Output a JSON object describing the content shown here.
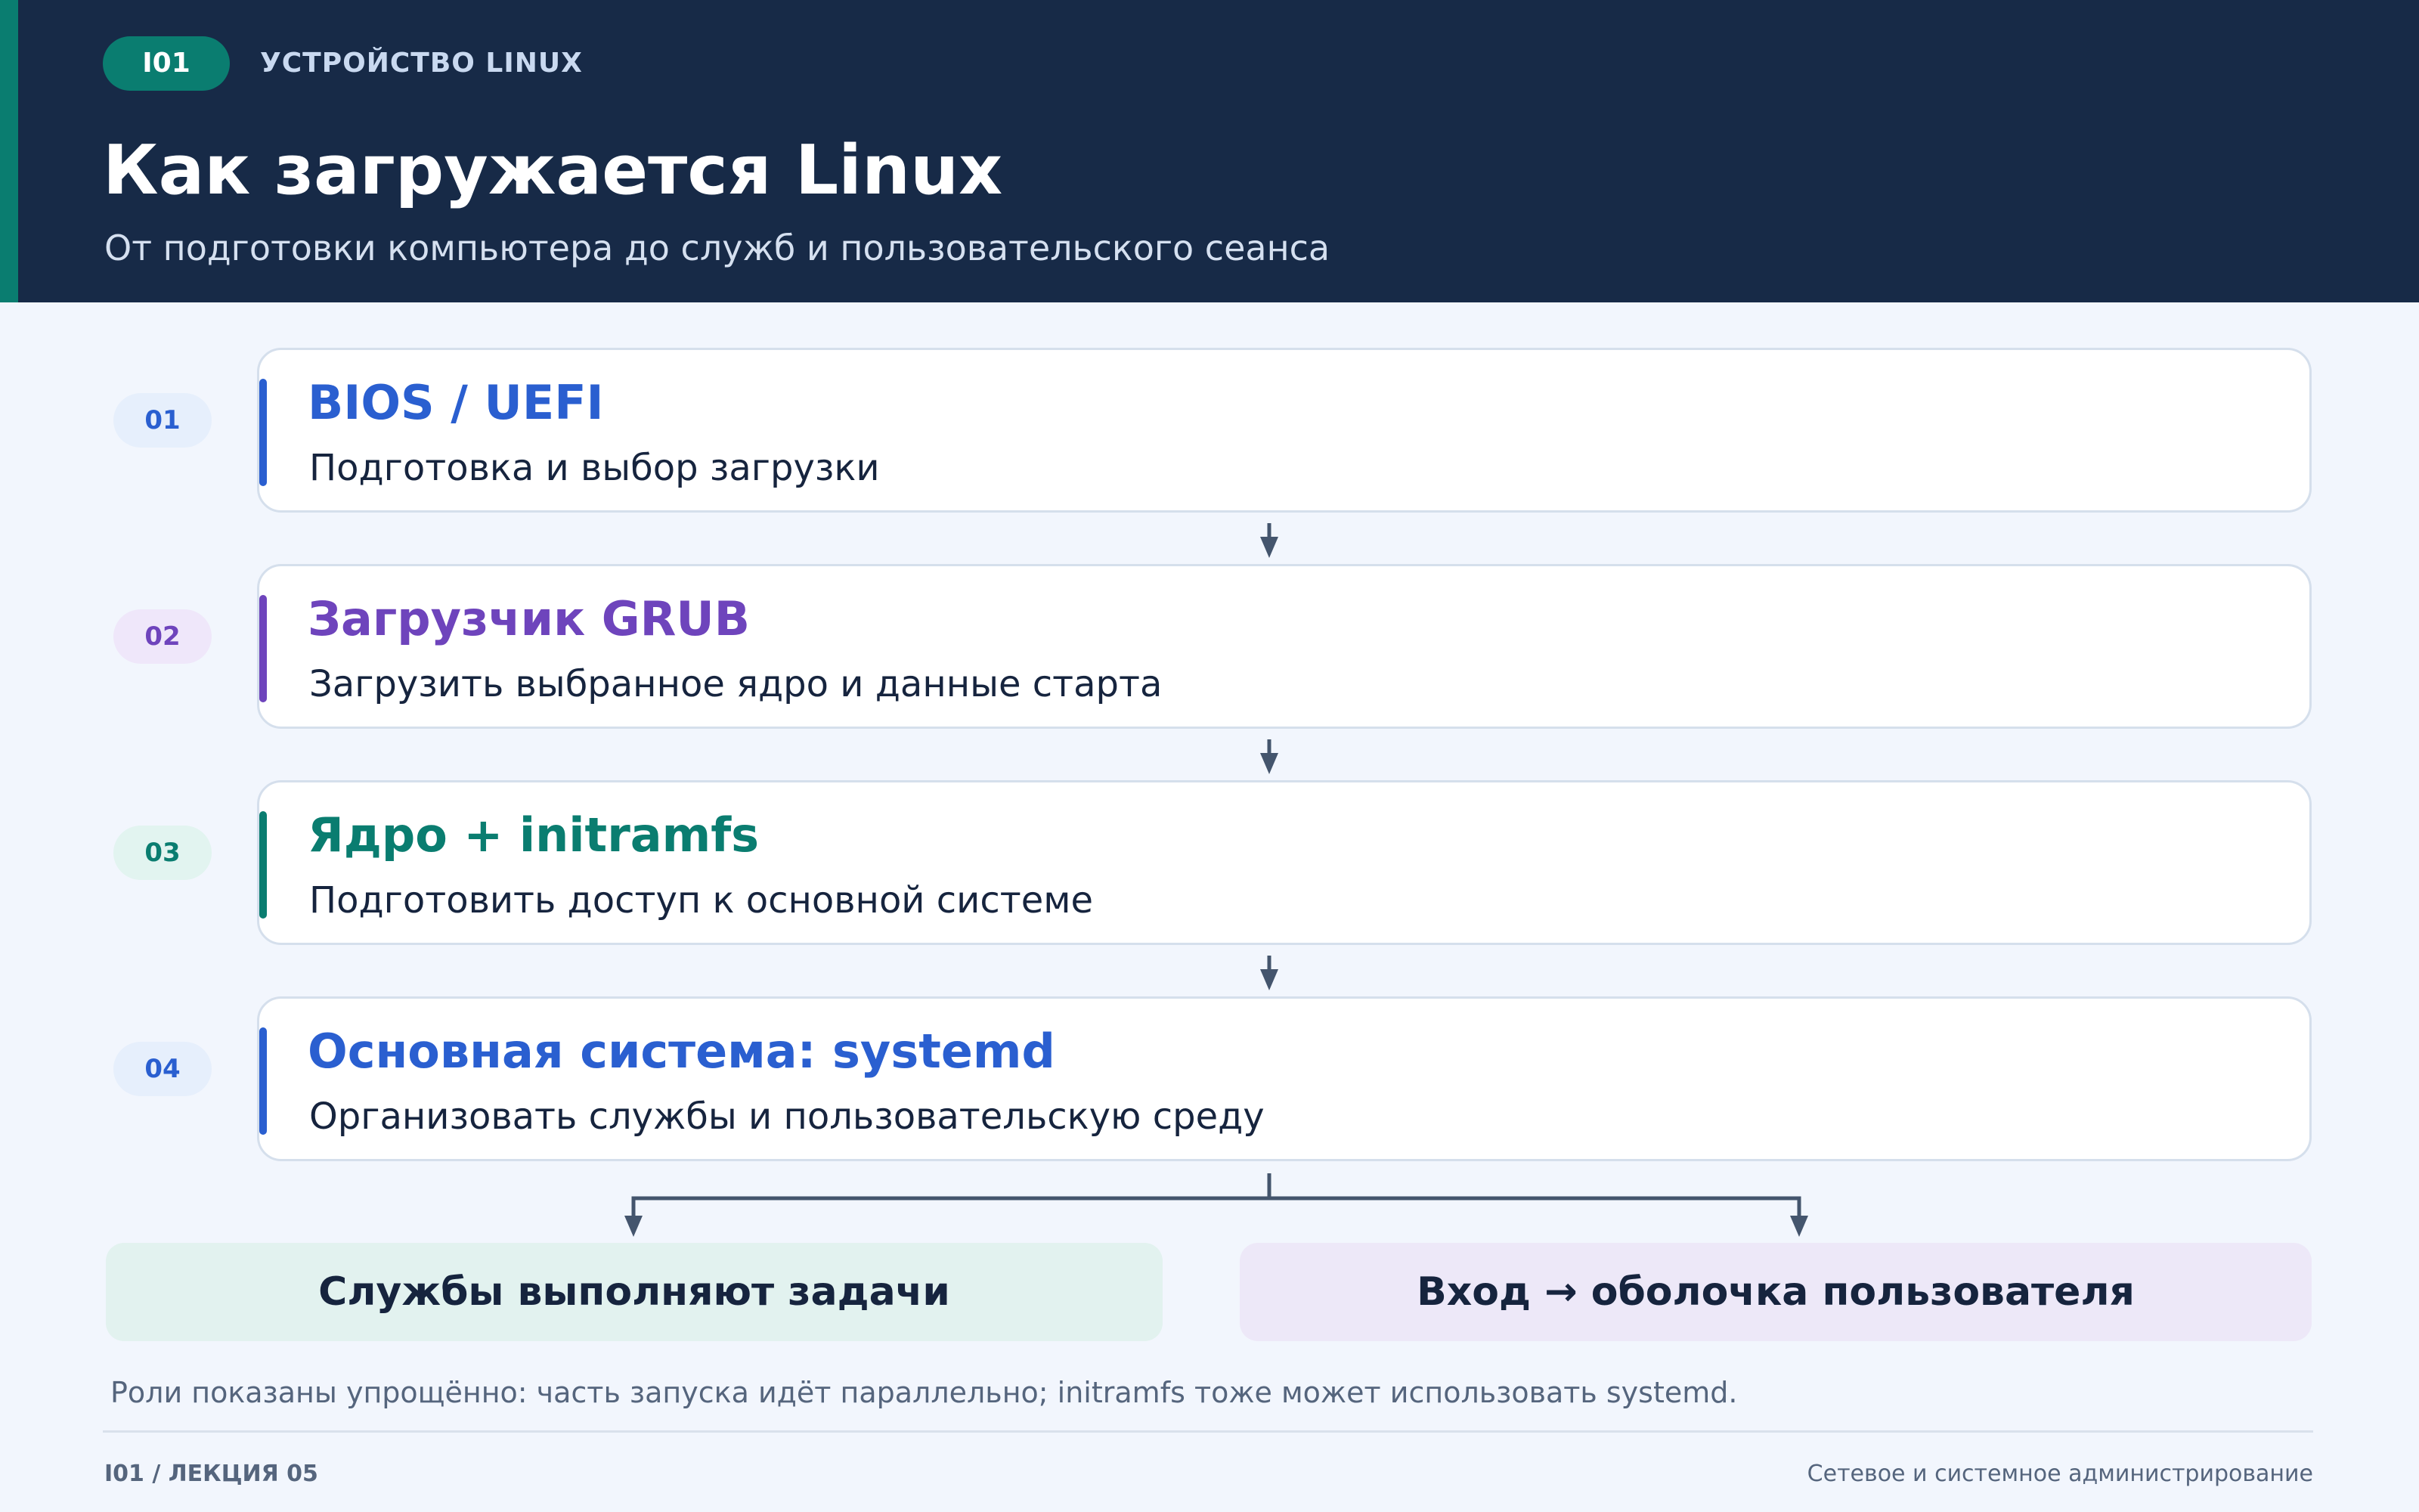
{
  "header": {
    "course_code": "I01",
    "topic": "УСТРОЙСТВО LINUX",
    "title": "Как загружается Linux",
    "subtitle": "От подготовки компьютера до служб и пользовательского сеанса"
  },
  "steps": [
    {
      "number": "01",
      "title": "BIOS / UEFI",
      "description": "Подготовка и выбор загрузки",
      "color": "#2a5fd0"
    },
    {
      "number": "02",
      "title": "Загрузчик GRUB",
      "description": "Загрузить выбранное ядро и данные старта",
      "color": "#6e44bc"
    },
    {
      "number": "03",
      "title": "Ядро + initramfs",
      "description": "Подготовить доступ к основной системе",
      "color": "#0a7d70"
    },
    {
      "number": "04",
      "title": "Основная система: systemd",
      "description": "Организовать службы и пользовательскую среду",
      "color": "#2a5fd0"
    }
  ],
  "outcomes": {
    "services": "Службы выполняют задачи",
    "login": "Вход → оболочка пользователя"
  },
  "footnote": "Роли показаны упрощённо: часть запуска идёт параллельно; initramfs тоже может использовать systemd.",
  "footer": {
    "left": "I01 / ЛЕКЦИЯ 05",
    "right": "Сетевое и системное администрирование"
  },
  "colors": {
    "header_bg": "#172a47",
    "accent_teal": "#0a7d70",
    "connector": "#44556d"
  }
}
